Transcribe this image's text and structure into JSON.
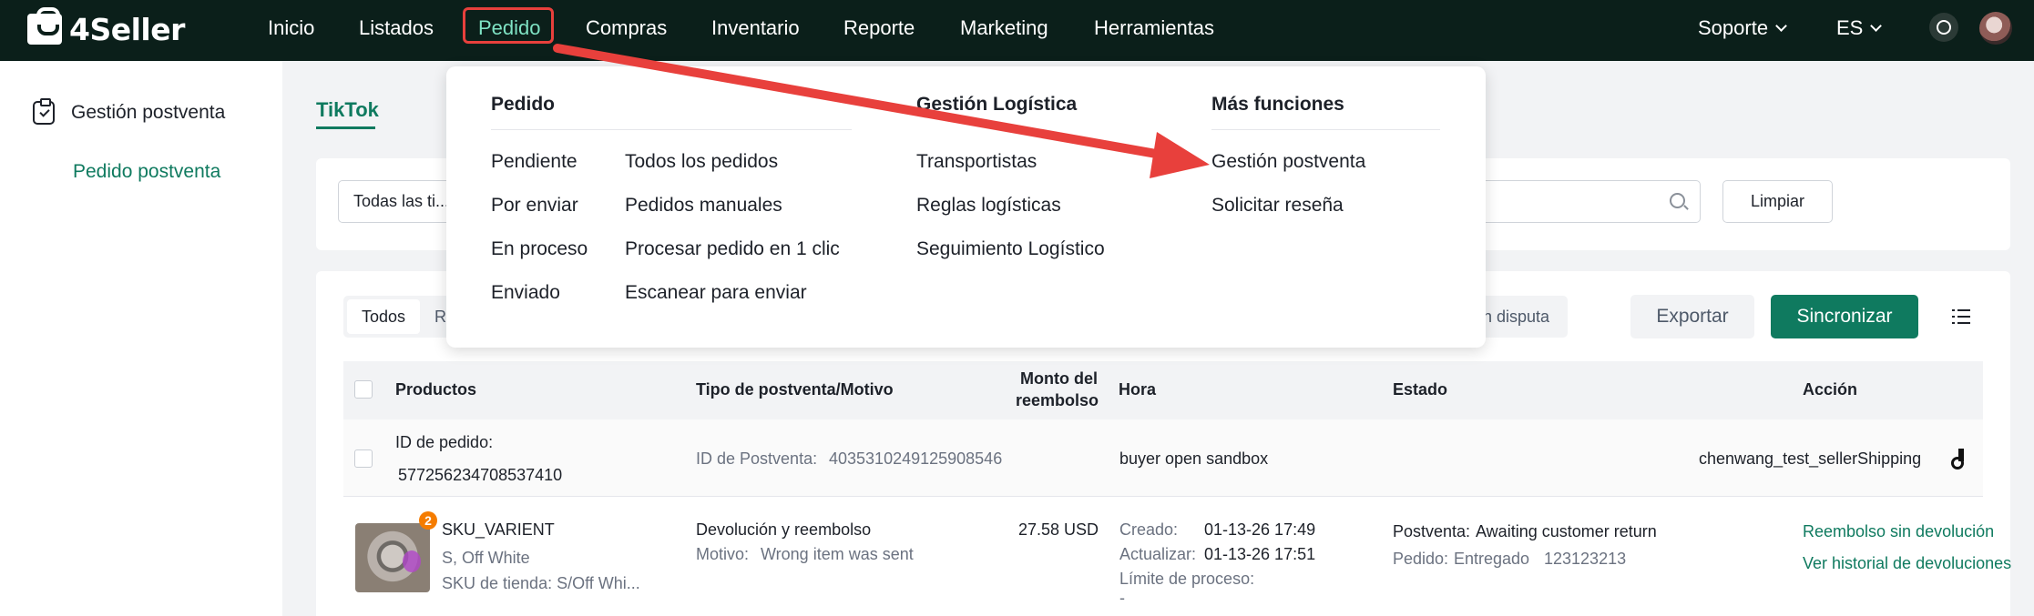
{
  "app": {
    "logo_text": "4Seller"
  },
  "topnav": {
    "items": [
      "Inicio",
      "Listados",
      "Pedido",
      "Compras",
      "Inventario",
      "Reporte",
      "Marketing",
      "Herramientas"
    ],
    "active": "Pedido",
    "support": "Soporte",
    "language": "ES"
  },
  "sidebar": {
    "title": "Gestión postventa",
    "item": "Pedido postventa"
  },
  "tabs": {
    "active": "TikTok"
  },
  "filters": {
    "select_value": "Todas las ti...",
    "clear_button": "Limpiar"
  },
  "toolbar": {
    "segment_all": "Todos",
    "segment_r": "R",
    "segment_dispute": "n disputa",
    "export_button": "Exportar",
    "sync_button": "Sincronizar"
  },
  "table": {
    "headers": {
      "products": "Productos",
      "type_reason": "Tipo de postventa/Motivo",
      "refund_amount_1": "Monto del",
      "refund_amount_2": "reembolso",
      "time": "Hora",
      "status": "Estado",
      "action": "Acción"
    },
    "order": {
      "order_id_label": "ID de pedido:",
      "order_id": "577256234708537410",
      "aftersale_id_label": "ID de Postventa:",
      "aftersale_id": "4035310249125908546",
      "event": "buyer open sandbox",
      "shop": "chenwang_test_sellerShipping"
    },
    "item": {
      "badge": "2",
      "sku": "SKU_VARIENT",
      "variant": "S, Off White",
      "store_sku": "SKU de tienda: S/Off Whi...",
      "type": "Devolución y reembolso",
      "reason_label": "Motivo:",
      "reason": "Wrong item was sent",
      "amount": "27.58 USD",
      "created_label": "Creado:",
      "created": "01-13-26 17:49",
      "updated_label": "Actualizar:",
      "updated": "01-13-26 17:51",
      "limit_label": "Límite de proceso:",
      "limit": "-",
      "aftersale_status_label": "Postventa:",
      "aftersale_status": "Awaiting customer return",
      "order_status_label": "Pedido:",
      "order_status": "Entregado",
      "order_status_code": "123123213",
      "action_1": "Reembolso sin devolución",
      "action_2": "Ver historial de devoluciones"
    }
  },
  "dropdown": {
    "col1_head": "Pedido",
    "col1a": [
      "Pendiente",
      "Por enviar",
      "En proceso",
      "Enviado"
    ],
    "col1b": [
      "Todos los pedidos",
      "Pedidos manuales",
      "Procesar pedido en 1 clic",
      "Escanear para enviar"
    ],
    "col2_head": "Gestión Logística",
    "col2": [
      "Transportistas",
      "Reglas logísticas",
      "Seguimiento Logístico"
    ],
    "col3_head": "Más funciones",
    "col3": [
      "Gestión postventa",
      "Solicitar reseña"
    ]
  },
  "colors": {
    "brand": "#0f7a5f",
    "nav_bg": "#0b1f1a",
    "annotation": "#e8403c"
  }
}
